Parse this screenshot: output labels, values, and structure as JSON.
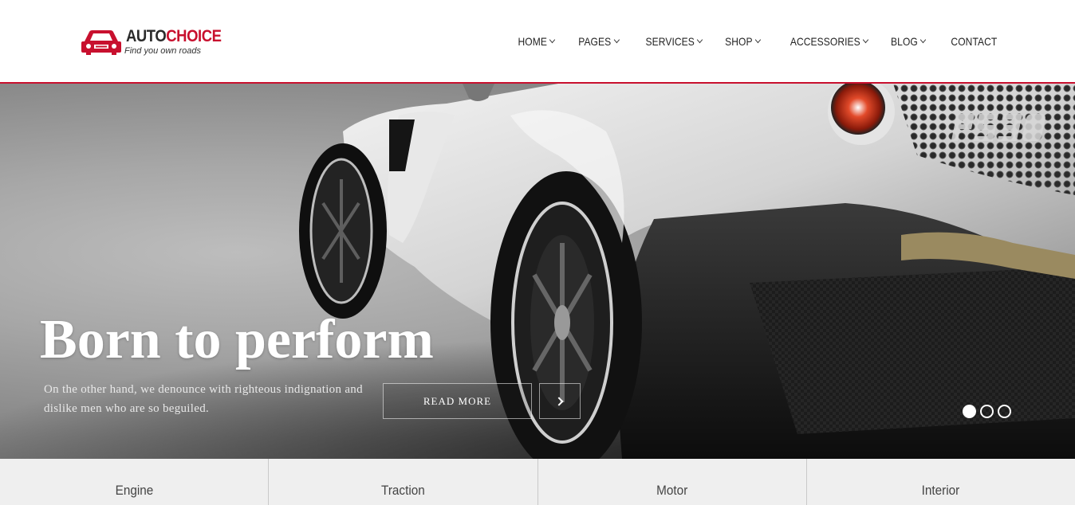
{
  "brand": {
    "name_part1": "AUTO",
    "name_part2": "CHOICE",
    "tagline": "Find you own roads",
    "accent_color": "#c8102e"
  },
  "nav": {
    "items": [
      {
        "label": "HOME",
        "has_dropdown": true
      },
      {
        "label": "PAGES",
        "has_dropdown": true
      },
      {
        "label": "SERVICES",
        "has_dropdown": true
      },
      {
        "label": "SHOP",
        "has_dropdown": true
      },
      {
        "label": "ACCESSORIES",
        "has_dropdown": true
      },
      {
        "label": "BLOG",
        "has_dropdown": true
      },
      {
        "label": "CONTACT",
        "has_dropdown": false
      }
    ]
  },
  "hero": {
    "title": "Born to perform",
    "description": "On the other hand, we denounce with righteous indignation and dislike men who are so beguiled.",
    "read_more_label": "READ MORE",
    "next_icon": "chevron-right-icon",
    "slides_total": 3,
    "active_slide": 1,
    "car_plate": "P538"
  },
  "features": {
    "items": [
      {
        "label": "Engine"
      },
      {
        "label": "Traction"
      },
      {
        "label": "Motor"
      },
      {
        "label": "Interior"
      }
    ]
  }
}
